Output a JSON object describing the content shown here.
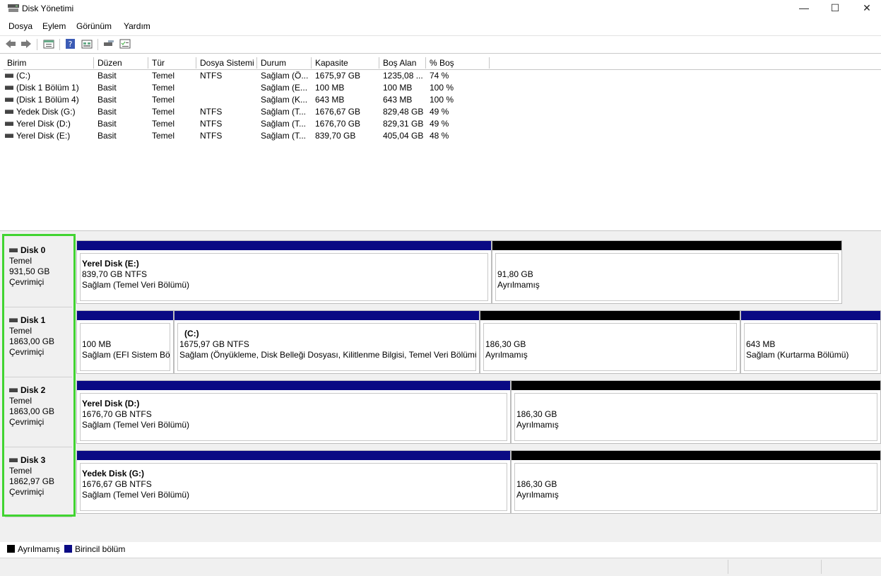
{
  "window": {
    "title": "Disk Yönetimi",
    "minimize": "—",
    "maximize": "☐",
    "close": "✕"
  },
  "menu": [
    "Dosya",
    "Eylem",
    "Görünüm",
    "Yardım"
  ],
  "columns": [
    "Birim",
    "Düzen",
    "Tür",
    "Dosya Sistemi",
    "Durum",
    "Kapasite",
    "Boş Alan",
    "% Boş"
  ],
  "volumes": [
    [
      "(C:)",
      "Basit",
      "Temel",
      "NTFS",
      "Sağlam (Ö...",
      "1675,97 GB",
      "1235,08 ...",
      "74 %"
    ],
    [
      "(Disk 1 Bölüm 1)",
      "Basit",
      "Temel",
      "",
      "Sağlam (E...",
      "100 MB",
      "100 MB",
      "100 %"
    ],
    [
      "(Disk 1 Bölüm 4)",
      "Basit",
      "Temel",
      "",
      "Sağlam (K...",
      "643 MB",
      "643 MB",
      "100 %"
    ],
    [
      "Yedek Disk (G:)",
      "Basit",
      "Temel",
      "NTFS",
      "Sağlam (T...",
      "1676,67 GB",
      "829,48 GB",
      "49 %"
    ],
    [
      "Yerel Disk (D:)",
      "Basit",
      "Temel",
      "NTFS",
      "Sağlam (T...",
      "1676,70 GB",
      "829,31 GB",
      "49 %"
    ],
    [
      "Yerel Disk (E:)",
      "Basit",
      "Temel",
      "NTFS",
      "Sağlam (T...",
      "839,70 GB",
      "405,04 GB",
      "48 %"
    ]
  ],
  "disks": [
    {
      "name": "Disk 0",
      "type": "Temel",
      "size": "931,50 GB",
      "status": "Çevrimiçi",
      "partitions": [
        {
          "title": "Yerel Disk  (E:)",
          "line1": "839,70 GB NTFS",
          "line2": "Sağlam (Temel Veri Bölümü)",
          "kind": "primary"
        },
        {
          "title": "",
          "line1": "91,80 GB",
          "line2": "Ayrılmamış",
          "kind": "unallocated"
        }
      ]
    },
    {
      "name": "Disk 1",
      "type": "Temel",
      "size": "1863,00 GB",
      "status": "Çevrimiçi",
      "partitions": [
        {
          "title": "",
          "line1": "100 MB",
          "line2": "Sağlam (EFI Sistem Bölümü)",
          "kind": "primary"
        },
        {
          "title": "(C:)",
          "line1": "1675,97 GB NTFS",
          "line2": "Sağlam (Önyükleme, Disk Belleği Dosyası, Kilitlenme Bilgisi, Temel Veri Bölümü)",
          "kind": "primary"
        },
        {
          "title": "",
          "line1": "186,30 GB",
          "line2": "Ayrılmamış",
          "kind": "unallocated"
        },
        {
          "title": "",
          "line1": "643 MB",
          "line2": "Sağlam (Kurtarma Bölümü)",
          "kind": "primary"
        }
      ]
    },
    {
      "name": "Disk 2",
      "type": "Temel",
      "size": "1863,00 GB",
      "status": "Çevrimiçi",
      "partitions": [
        {
          "title": "Yerel Disk  (D:)",
          "line1": "1676,70 GB NTFS",
          "line2": "Sağlam (Temel Veri Bölümü)",
          "kind": "primary"
        },
        {
          "title": "",
          "line1": "186,30 GB",
          "line2": "Ayrılmamış",
          "kind": "unallocated"
        }
      ]
    },
    {
      "name": "Disk 3",
      "type": "Temel",
      "size": "1862,97 GB",
      "status": "Çevrimiçi",
      "partitions": [
        {
          "title": "Yedek Disk  (G:)",
          "line1": "1676,67 GB NTFS",
          "line2": "Sağlam (Temel Veri Bölümü)",
          "kind": "primary"
        },
        {
          "title": "",
          "line1": "186,30 GB",
          "line2": "Ayrılmamış",
          "kind": "unallocated"
        }
      ]
    }
  ],
  "legend": {
    "unallocated": "Ayrılmamış",
    "primary": "Birincil bölüm"
  },
  "colors": {
    "primary": "#0a0a84",
    "unallocated": "#000000",
    "highlight": "#41d431"
  }
}
